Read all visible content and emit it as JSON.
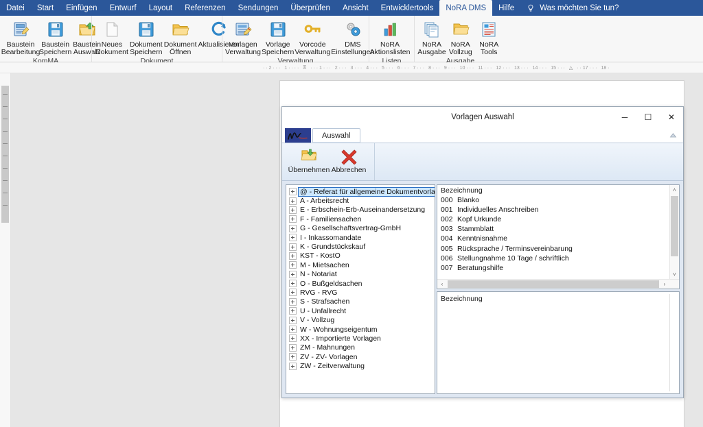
{
  "app": {
    "menu_tabs": [
      {
        "label": "Datei",
        "active": false
      },
      {
        "label": "Start",
        "active": false
      },
      {
        "label": "Einfügen",
        "active": false
      },
      {
        "label": "Entwurf",
        "active": false
      },
      {
        "label": "Layout",
        "active": false
      },
      {
        "label": "Referenzen",
        "active": false
      },
      {
        "label": "Sendungen",
        "active": false
      },
      {
        "label": "Überprüfen",
        "active": false
      },
      {
        "label": "Ansicht",
        "active": false
      },
      {
        "label": "Entwicklertools",
        "active": false
      },
      {
        "label": "NoRA DMS",
        "active": true
      },
      {
        "label": "Hilfe",
        "active": false
      }
    ],
    "tell_me": "Was möchten Sie tun?",
    "tell_me_icon": "lightbulb-icon",
    "accent_color": "#2b579a",
    "ribbon_groups": [
      {
        "label": "KomMA",
        "buttons": [
          {
            "label": "Baustein\nBearbeitung",
            "icon": "document-edit-icon"
          },
          {
            "label": "Baustein\nSpeichern",
            "icon": "floppy-save-icon"
          },
          {
            "label": "Baustein\nAuswahl",
            "icon": "folder-up-icon"
          }
        ]
      },
      {
        "label": "Dokument",
        "buttons": [
          {
            "label": "Neues\nDokument",
            "icon": "new-document-icon"
          },
          {
            "label": "Dokument\nSpeichern",
            "icon": "floppy-save-icon"
          },
          {
            "label": "Dokument\nÖffnen",
            "icon": "open-folder-icon"
          },
          {
            "label": "Aktualisieren",
            "icon": "refresh-icon"
          }
        ]
      },
      {
        "label": "Verwaltung",
        "buttons": [
          {
            "label": "Vorlagen\nVerwaltung",
            "icon": "template-edit-icon"
          },
          {
            "label": "Vorlage\nSpeichern",
            "icon": "floppy-save-icon"
          },
          {
            "label": "Vorcode\nVerwaltung",
            "icon": "key-icon"
          },
          {
            "label": "DMS\nEinstellungen",
            "icon": "gears-icon"
          }
        ]
      },
      {
        "label": "Listen",
        "buttons": [
          {
            "label": "NoRA\nAktionslisten",
            "icon": "bar-chart-icon"
          }
        ]
      },
      {
        "label": "Ausgabe",
        "buttons": [
          {
            "label": "NoRA\nAusgabe",
            "icon": "documents-stack-icon"
          },
          {
            "label": "NoRA\nVollzug",
            "icon": "folder-open-icon"
          },
          {
            "label": "NoRA\nTools",
            "icon": "form-icon"
          }
        ]
      }
    ],
    "ruler": {
      "left_marks": [
        "2",
        "1"
      ],
      "right_marks": [
        "1",
        "2",
        "3",
        "4",
        "5",
        "6",
        "7",
        "8",
        "9",
        "10",
        "11",
        "12",
        "13",
        "14",
        "15",
        "17",
        "18"
      ]
    }
  },
  "dialog": {
    "title": "Vorlagen Auswahl",
    "window_controls": [
      {
        "name": "minimize",
        "glyph": "─"
      },
      {
        "name": "maximize",
        "glyph": "☐"
      },
      {
        "name": "close",
        "glyph": "✕"
      }
    ],
    "logo_tab": {
      "name": "nora-logo",
      "text": "NoRA"
    },
    "tabs": [
      {
        "label": "Auswahl",
        "active": true
      }
    ],
    "help_icon": "help-collapse-icon",
    "ribbon_group": {
      "buttons": [
        {
          "label": "Übernehmen",
          "icon": "folder-accept-icon"
        },
        {
          "label": "Abbrechen",
          "icon": "red-x-icon"
        }
      ]
    },
    "tree": {
      "selected_index": 0,
      "nodes": [
        {
          "label": "@ - Referat für allgemeine Dokumentvorlagen"
        },
        {
          "label": "A - Arbeitsrecht"
        },
        {
          "label": "E - Erbschein-Erb-Auseinandersetzung"
        },
        {
          "label": "F - Familiensachen"
        },
        {
          "label": "G - Gesellschaftsvertrag-GmbH"
        },
        {
          "label": "I - Inkassomandate"
        },
        {
          "label": "K - Grundstückskauf"
        },
        {
          "label": "KST - KostO"
        },
        {
          "label": "M - Mietsachen"
        },
        {
          "label": "N - Notariat"
        },
        {
          "label": "O - Bußgeldsachen"
        },
        {
          "label": "RVG - RVG"
        },
        {
          "label": "S - Strafsachen"
        },
        {
          "label": "U - Unfallrecht"
        },
        {
          "label": "V - Vollzug"
        },
        {
          "label": "W - Wohnungseigentum"
        },
        {
          "label": "XX - Importierte Vorlagen"
        },
        {
          "label": "ZM - Mahnungen"
        },
        {
          "label": "ZV - ZV- Vorlagen"
        },
        {
          "label": "ZW - Zeitverwaltung"
        }
      ]
    },
    "list": {
      "header": "Bezeichnung",
      "rows": [
        {
          "num": "000",
          "label": "Blanko"
        },
        {
          "num": "001",
          "label": "Individuelles Anschreiben"
        },
        {
          "num": "002",
          "label": "Kopf Urkunde"
        },
        {
          "num": "003",
          "label": "Stammblatt"
        },
        {
          "num": "004",
          "label": "Kenntnisnahme"
        },
        {
          "num": "005",
          "label": "Rücksprache / Terminsvereinbarung"
        },
        {
          "num": "006",
          "label": "Stellungnahme 10 Tage / schriftlich"
        },
        {
          "num": "007",
          "label": "Beratungshilfe"
        }
      ],
      "scroll_up_glyph": "˄",
      "scroll_down_glyph": "˅",
      "scroll_left_glyph": "‹",
      "scroll_right_glyph": "›"
    },
    "detail": {
      "header": "Bezeichnung"
    }
  }
}
